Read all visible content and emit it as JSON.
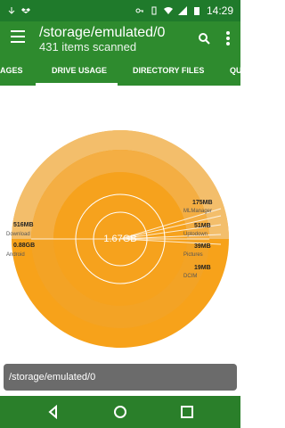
{
  "status": {
    "time": "14:29"
  },
  "appbar": {
    "title": "/storage/emulated/0",
    "subtitle": "431 items scanned"
  },
  "tabs": {
    "left_partial": "AGES",
    "active": "DRIVE USAGE",
    "right": "DIRECTORY FILES",
    "right_partial": "QU"
  },
  "chart": {
    "center_label": "1.67GB",
    "items": [
      {
        "size": "516MB",
        "name": "Download"
      },
      {
        "size": "0.88GB",
        "name": "Android"
      },
      {
        "size": "175MB",
        "name": "MLManager"
      },
      {
        "size": "51MB",
        "name": "Uptodown"
      },
      {
        "size": "39MB",
        "name": "Pictures"
      },
      {
        "size": "19MB",
        "name": "DCIM"
      }
    ]
  },
  "pathbar": {
    "text": "/storage/emulated/0"
  },
  "colors": {
    "appbar": "#2e8b2e",
    "status": "#1f7a2b",
    "accent": "#f6a21d"
  }
}
